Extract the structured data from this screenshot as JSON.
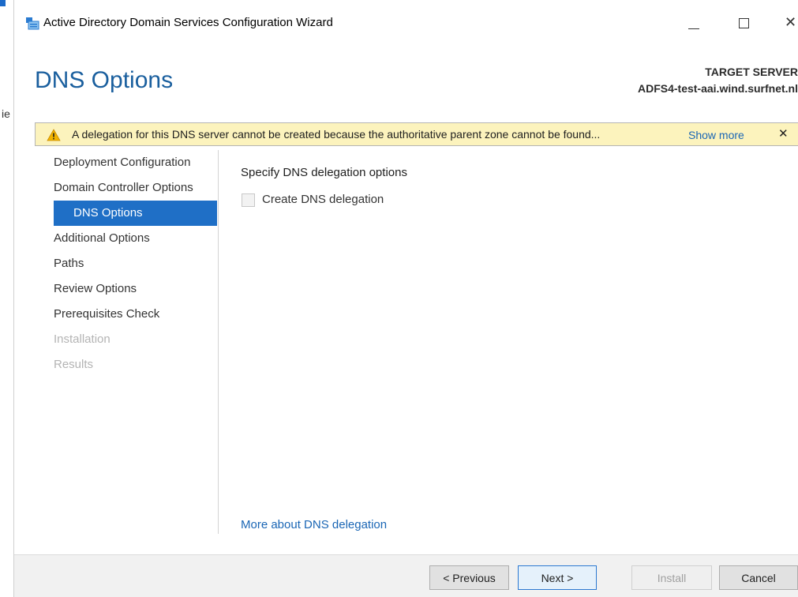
{
  "window": {
    "title": "Active Directory Domain Services Configuration Wizard",
    "close_glyph": "✕"
  },
  "background": {
    "partial_text": "ie"
  },
  "page": {
    "title": "DNS Options"
  },
  "target_server": {
    "label": "TARGET SERVER",
    "name": "ADFS4-test-aai.wind.surfnet.nl"
  },
  "warning": {
    "message": "A delegation for this DNS server cannot be created because the authoritative parent zone cannot be found...",
    "show_more": "Show more",
    "close": "✕"
  },
  "nav": {
    "items": [
      {
        "label": "Deployment Configuration",
        "state": "normal"
      },
      {
        "label": "Domain Controller Options",
        "state": "normal"
      },
      {
        "label": "DNS Options",
        "state": "active"
      },
      {
        "label": "Additional Options",
        "state": "normal"
      },
      {
        "label": "Paths",
        "state": "normal"
      },
      {
        "label": "Review Options",
        "state": "normal"
      },
      {
        "label": "Prerequisites Check",
        "state": "normal"
      },
      {
        "label": "Installation",
        "state": "disabled"
      },
      {
        "label": "Results",
        "state": "disabled"
      }
    ]
  },
  "content": {
    "heading": "Specify DNS delegation options",
    "checkbox_label": "Create DNS delegation",
    "checkbox_checked": false,
    "more_link": "More about DNS delegation"
  },
  "buttons": {
    "previous": "< Previous",
    "next": "Next >",
    "install": "Install",
    "cancel": "Cancel"
  },
  "colors": {
    "accent": "#1f6fc6",
    "title": "#1a5f9e",
    "warning_bg": "#fcf3bd",
    "link": "#1a66b5"
  }
}
